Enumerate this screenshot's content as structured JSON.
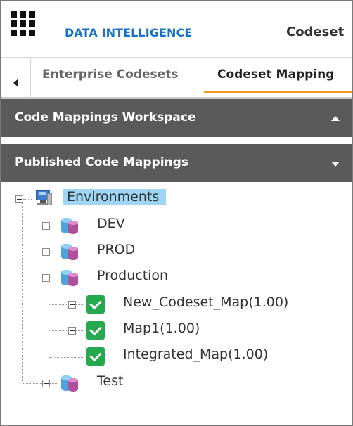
{
  "header": {
    "app_title": "DATA INTELLIGENCE",
    "breadcrumb": "Codeset",
    "menu_icon": "grid-menu-icon"
  },
  "tabs": {
    "items": [
      {
        "label": "Enterprise Codesets",
        "active": false
      },
      {
        "label": "Codeset Mapping",
        "active": true
      }
    ],
    "accent_color": "#f29a25"
  },
  "panels": {
    "workspace": {
      "label": "Code Mappings Workspace",
      "state": "expanded"
    },
    "published": {
      "label": "Published Code Mappings",
      "state": "collapsed"
    }
  },
  "tree": {
    "root": {
      "label": "Environments",
      "icon": "computer-icon",
      "expanded": true,
      "selected": true
    },
    "environments": [
      {
        "label": "DEV",
        "icon": "database-icon",
        "expanded": false
      },
      {
        "label": "PROD",
        "icon": "database-icon",
        "expanded": false
      },
      {
        "label": "Production",
        "icon": "database-icon",
        "expanded": true,
        "children": [
          {
            "label": "New_Codeset_Map(1.00)",
            "icon": "check-icon",
            "expandable": true
          },
          {
            "label": "Map1(1.00)",
            "icon": "check-icon",
            "expandable": true
          },
          {
            "label": "Integrated_Map(1.00)",
            "icon": "check-icon",
            "expandable": false
          }
        ]
      },
      {
        "label": "Test",
        "icon": "database-icon",
        "expanded": false
      }
    ]
  }
}
